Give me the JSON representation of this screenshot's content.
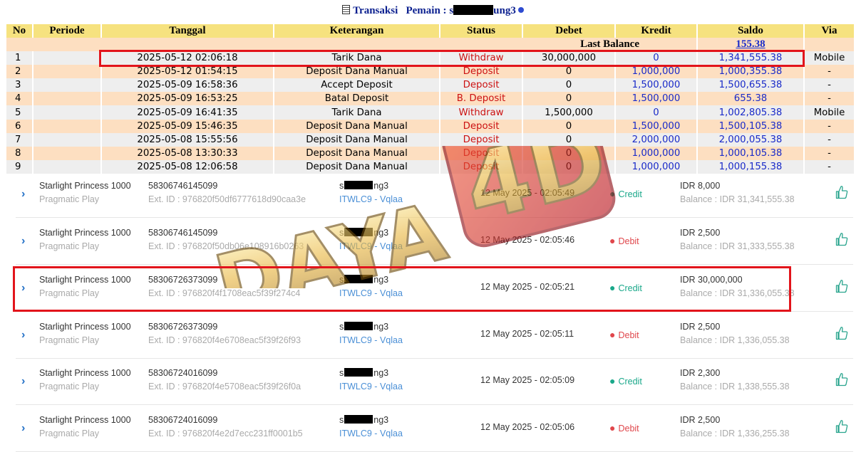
{
  "header": {
    "title": "Transaksi",
    "player_label": "Pemain :",
    "player_prefix": "s",
    "player_suffix": "ung3"
  },
  "transactions": {
    "columns": [
      "No",
      "Periode",
      "Tanggal",
      "Keterangan",
      "Status",
      "Debet",
      "Kredit",
      "Saldo",
      "Via"
    ],
    "last_balance_label": "Last Balance",
    "last_balance_value": "155.38",
    "rows": [
      {
        "no": "1",
        "periode": "",
        "tanggal": "2025-05-12 02:06:18",
        "keterangan": "Tarik Dana",
        "status": "Withdraw",
        "debet": "30,000,000",
        "kredit": "0",
        "saldo": "1,341,555.38",
        "via": "Mobile"
      },
      {
        "no": "2",
        "periode": "",
        "tanggal": "2025-05-12 01:54:15",
        "keterangan": "Deposit Dana Manual",
        "status": "Deposit",
        "debet": "0",
        "kredit": "1,000,000",
        "saldo": "1,000,355.38",
        "via": "-"
      },
      {
        "no": "3",
        "periode": "",
        "tanggal": "2025-05-09 16:58:36",
        "keterangan": "Accept Deposit",
        "status": "Deposit",
        "debet": "0",
        "kredit": "1,500,000",
        "saldo": "1,500,655.38",
        "via": "-"
      },
      {
        "no": "4",
        "periode": "",
        "tanggal": "2025-05-09 16:53:25",
        "keterangan": "Batal Deposit",
        "status": "B. Deposit",
        "debet": "0",
        "kredit": "1,500,000",
        "saldo": "655.38",
        "via": "-"
      },
      {
        "no": "5",
        "periode": "",
        "tanggal": "2025-05-09 16:41:35",
        "keterangan": "Tarik Dana",
        "status": "Withdraw",
        "debet": "1,500,000",
        "kredit": "0",
        "saldo": "1,002,805.38",
        "via": "Mobile"
      },
      {
        "no": "6",
        "periode": "",
        "tanggal": "2025-05-09 15:46:35",
        "keterangan": "Deposit Dana Manual",
        "status": "Deposit",
        "debet": "0",
        "kredit": "1,500,000",
        "saldo": "1,500,105.38",
        "via": "-"
      },
      {
        "no": "7",
        "periode": "",
        "tanggal": "2025-05-08 15:55:56",
        "keterangan": "Deposit Dana Manual",
        "status": "Deposit",
        "debet": "0",
        "kredit": "2,000,000",
        "saldo": "2,000,055.38",
        "via": "-"
      },
      {
        "no": "8",
        "periode": "",
        "tanggal": "2025-05-08 13:30:33",
        "keterangan": "Deposit Dana Manual",
        "status": "Deposit",
        "debet": "0",
        "kredit": "1,000,000",
        "saldo": "1,000,105.38",
        "via": "-"
      },
      {
        "no": "9",
        "periode": "",
        "tanggal": "2025-05-08 12:06:58",
        "keterangan": "Deposit Dana Manual",
        "status": "Deposit",
        "debet": "0",
        "kredit": "1,000,000",
        "saldo": "1,000,155.38",
        "via": "-"
      }
    ]
  },
  "activity": [
    {
      "game": "Starlight Princess 1000",
      "provider": "Pragmatic Play",
      "txid": "58306746145099",
      "extid": "Ext. ID : 976820f50df6777618d90caa3e",
      "user_prefix": "s",
      "user_suffix": "ng3",
      "agent": "ITWLC9 - Vqlaa",
      "time": "12 May 2025 - 02:05:49",
      "type": "Credit",
      "amount": "IDR 8,000",
      "balance": "Balance : IDR 31,341,555.38"
    },
    {
      "game": "Starlight Princess 1000",
      "provider": "Pragmatic Play",
      "txid": "58306746145099",
      "extid": "Ext. ID : 976820f50db06e108916b0263",
      "user_prefix": "s",
      "user_suffix": "ng3",
      "agent": "ITWLC9 - Vqlaa",
      "time": "12 May 2025 - 02:05:46",
      "type": "Debit",
      "amount": "IDR 2,500",
      "balance": "Balance : IDR 31,333,555.38"
    },
    {
      "game": "Starlight Princess 1000",
      "provider": "Pragmatic Play",
      "txid": "58306726373099",
      "extid": "Ext. ID : 976820f4f1708eac5f39f274c4",
      "user_prefix": "s",
      "user_suffix": "ng3",
      "agent": "ITWLC9 - Vqlaa",
      "time": "12 May 2025 - 02:05:21",
      "type": "Credit",
      "amount": "IDR 30,000,000",
      "balance": "Balance : IDR 31,336,055.38"
    },
    {
      "game": "Starlight Princess 1000",
      "provider": "Pragmatic Play",
      "txid": "58306726373099",
      "extid": "Ext. ID : 976820f4e6708eac5f39f26f93",
      "user_prefix": "s",
      "user_suffix": "ng3",
      "agent": "ITWLC9 - Vqlaa",
      "time": "12 May 2025 - 02:05:11",
      "type": "Debit",
      "amount": "IDR 2,500",
      "balance": "Balance : IDR 1,336,055.38"
    },
    {
      "game": "Starlight Princess 1000",
      "provider": "Pragmatic Play",
      "txid": "58306724016099",
      "extid": "Ext. ID : 976820f4e5708eac5f39f26f0a",
      "user_prefix": "s",
      "user_suffix": "ng3",
      "agent": "ITWLC9 - Vqlaa",
      "time": "12 May 2025 - 02:05:09",
      "type": "Credit",
      "amount": "IDR 2,300",
      "balance": "Balance : IDR 1,338,555.38"
    },
    {
      "game": "Starlight Princess 1000",
      "provider": "Pragmatic Play",
      "txid": "58306724016099",
      "extid": "Ext. ID : 976820f4e2d7ecc231ff0001b5",
      "user_prefix": "s",
      "user_suffix": "ng3",
      "agent": "ITWLC9 - Vqlaa",
      "time": "12 May 2025 - 02:05:06",
      "type": "Debit",
      "amount": "IDR 2,500",
      "balance": "Balance : IDR 1,336,255.38"
    }
  ],
  "watermark": {
    "text": "DAYA 4D"
  },
  "colors": {
    "header_bg": "#f6e27f",
    "row_odd": "#eeeeee",
    "row_even": "#fddfc1",
    "status_red": "#cc1111",
    "value_blue": "#1a2bc9",
    "credit_green": "#1aa88a",
    "debit_red": "#e0474c",
    "highlight": "#e2141b"
  }
}
